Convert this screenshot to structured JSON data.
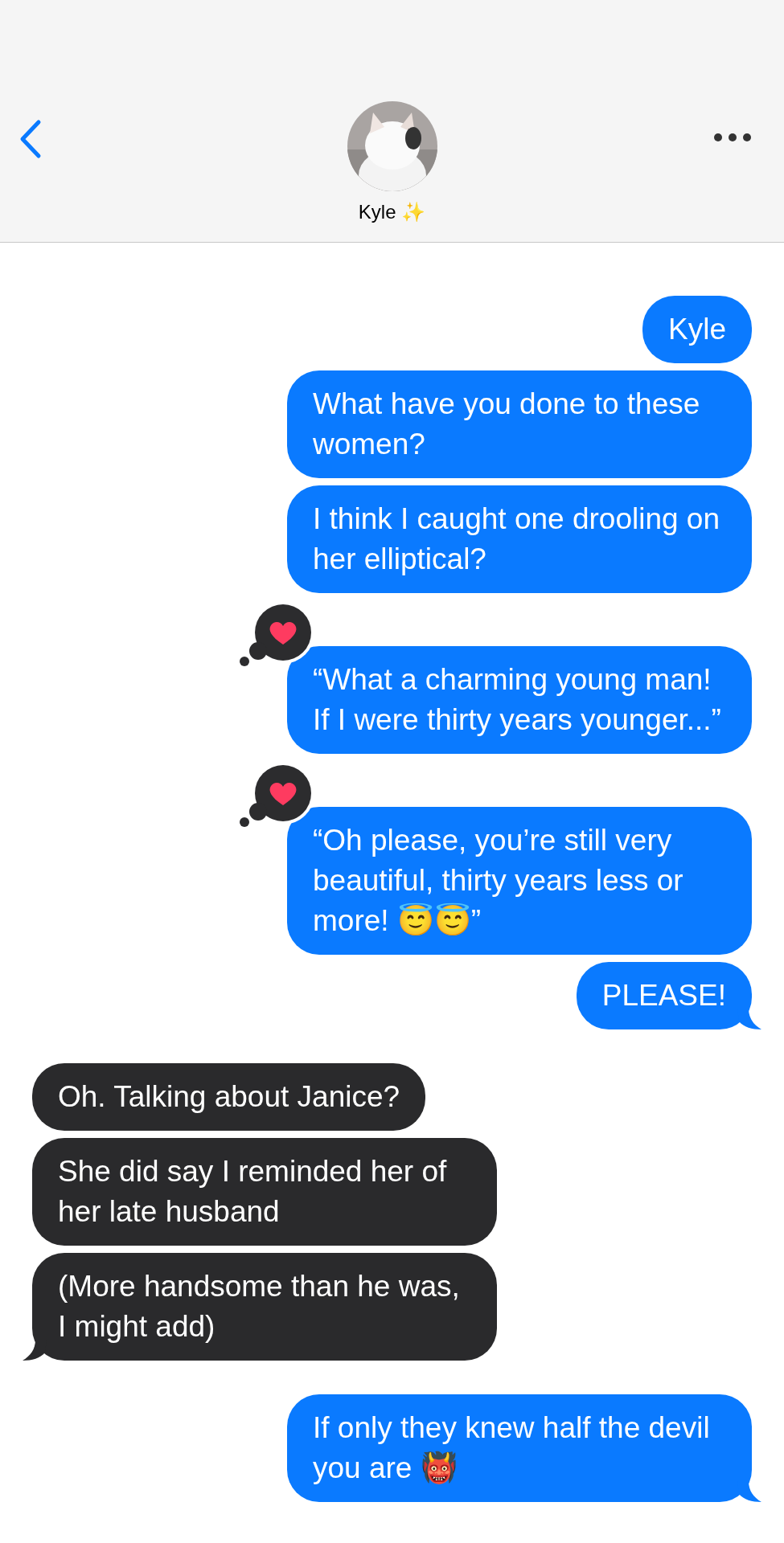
{
  "header": {
    "contact_name": "Kyle ✨"
  },
  "messages": [
    {
      "kind": "sent",
      "text": "Kyle",
      "tail": false,
      "liked": false
    },
    {
      "kind": "sent",
      "text": "What have you done to these women?",
      "tail": false,
      "liked": false
    },
    {
      "kind": "sent",
      "text": "I think I caught one drooling on her elliptical?",
      "tail": false,
      "liked": false
    },
    {
      "kind": "sent",
      "text": "“What a charming young man! If I were thirty years younger...”",
      "tail": false,
      "liked": true
    },
    {
      "kind": "sent",
      "text": "“Oh please, you’re still very beautiful, thirty years less or more! 😇😇”",
      "tail": false,
      "liked": true
    },
    {
      "kind": "sent",
      "text": "PLEASE!",
      "tail": true,
      "liked": false
    },
    {
      "kind": "received",
      "text": "Oh. Talking about Janice?",
      "tail": false,
      "liked": false
    },
    {
      "kind": "received",
      "text": "She did say I reminded her of her late husband",
      "tail": false,
      "liked": false
    },
    {
      "kind": "received",
      "text": "(More handsome than he was, I might add)",
      "tail": true,
      "liked": false
    },
    {
      "kind": "sent",
      "text": "If only they knew half the devil you are 👹",
      "tail": true,
      "liked": false
    }
  ]
}
